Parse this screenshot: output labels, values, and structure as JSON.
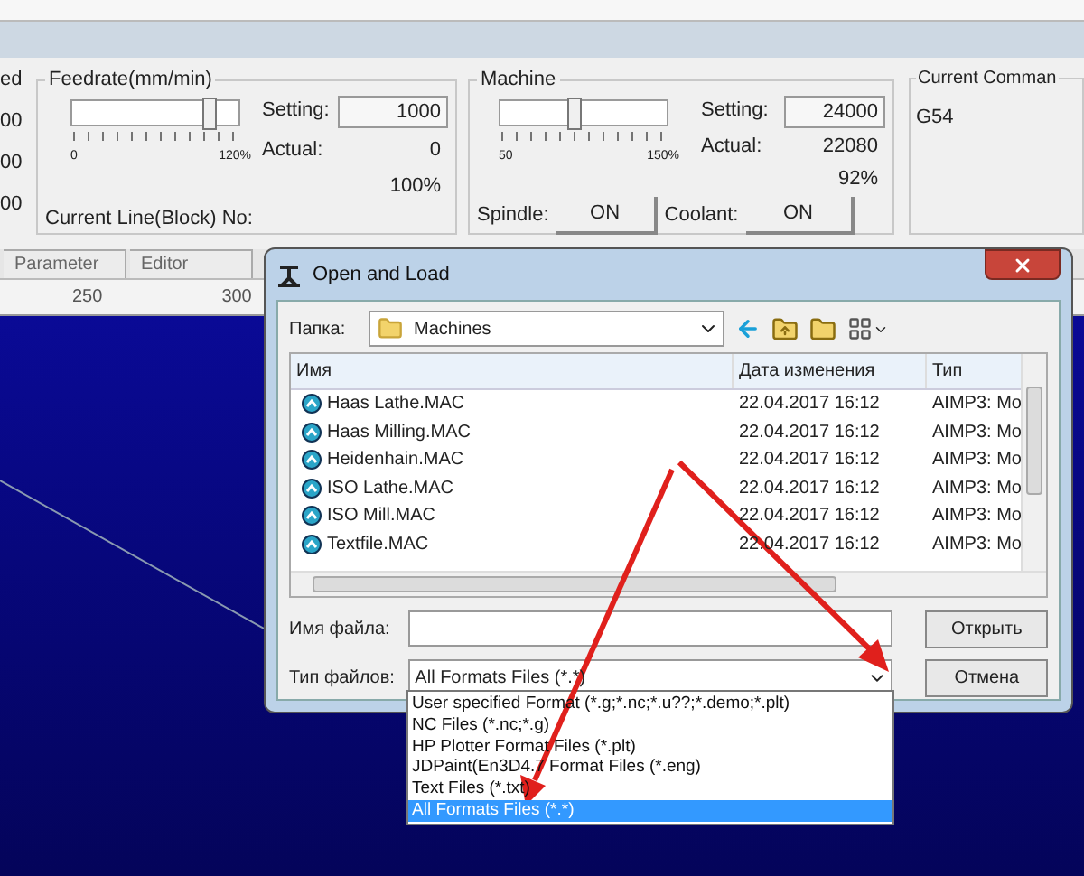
{
  "left_group": {
    "title": "ed",
    "values": [
      "00",
      "00",
      "00"
    ]
  },
  "feedrate": {
    "title": "Feedrate(mm/min)",
    "level": 0.83,
    "scale_min": "0",
    "scale_max": "120%",
    "setting_label": "Setting:",
    "setting": "1000",
    "actual_label": "Actual:",
    "actual": "0",
    "percent": "100%",
    "current_line_label": "Current Line(Block) No:"
  },
  "machine": {
    "title": "Machine",
    "level": 0.45,
    "scale_min": "50",
    "scale_max": "150%",
    "setting_label": "Setting:",
    "setting": "24000",
    "actual_label": "Actual:",
    "actual": "22080",
    "percent": "92%",
    "spindle_label": "Spindle:",
    "spindle_button": "ON",
    "coolant_label": "Coolant:",
    "coolant_button": "ON"
  },
  "current_command": {
    "title": "Current Comman",
    "value": "G54"
  },
  "tabs": [
    {
      "label": "Parameter"
    },
    {
      "label": "Editor"
    }
  ],
  "ruler": [
    "250",
    "300"
  ],
  "dialog": {
    "title": "Open and Load",
    "folder_label": "Папка:",
    "folder": "Machines",
    "columns": [
      "Имя",
      "Дата изменения",
      "Тип"
    ],
    "rows": [
      {
        "name": "Haas Lathe.MAC",
        "date": "22.04.2017 16:12",
        "type": "AIMP3: Mo"
      },
      {
        "name": "Haas Milling.MAC",
        "date": "22.04.2017 16:12",
        "type": "AIMP3: Mo"
      },
      {
        "name": "Heidenhain.MAC",
        "date": "22.04.2017 16:12",
        "type": "AIMP3: Mo"
      },
      {
        "name": "ISO Lathe.MAC",
        "date": "22.04.2017 16:12",
        "type": "AIMP3: Mo"
      },
      {
        "name": "ISO Mill.MAC",
        "date": "22.04.2017 16:12",
        "type": "AIMP3: Mo"
      },
      {
        "name": "Textfile.MAC",
        "date": "22.04.2017 16:12",
        "type": "AIMP3: Mo"
      }
    ],
    "filename_label": "Имя файла:",
    "filetype_label": "Тип файлов:",
    "filetype": "All Formats Files (*.*)",
    "open_button": "Открыть",
    "cancel_button": "Отмена",
    "filetype_options": [
      {
        "label": "User specified Format (*.g;*.nc;*.u??;*.demo;*.plt)",
        "selected": false
      },
      {
        "label": "NC Files (*.nc;*.g)",
        "selected": false
      },
      {
        "label": "HP Plotter Format Files (*.plt)",
        "selected": false
      },
      {
        "label": "JDPaint(En3D4.7 Format Files (*.eng)",
        "selected": false
      },
      {
        "label": "Text Files (*.txt)",
        "selected": false
      },
      {
        "label": "All Formats Files (*.*)",
        "selected": true
      }
    ]
  }
}
